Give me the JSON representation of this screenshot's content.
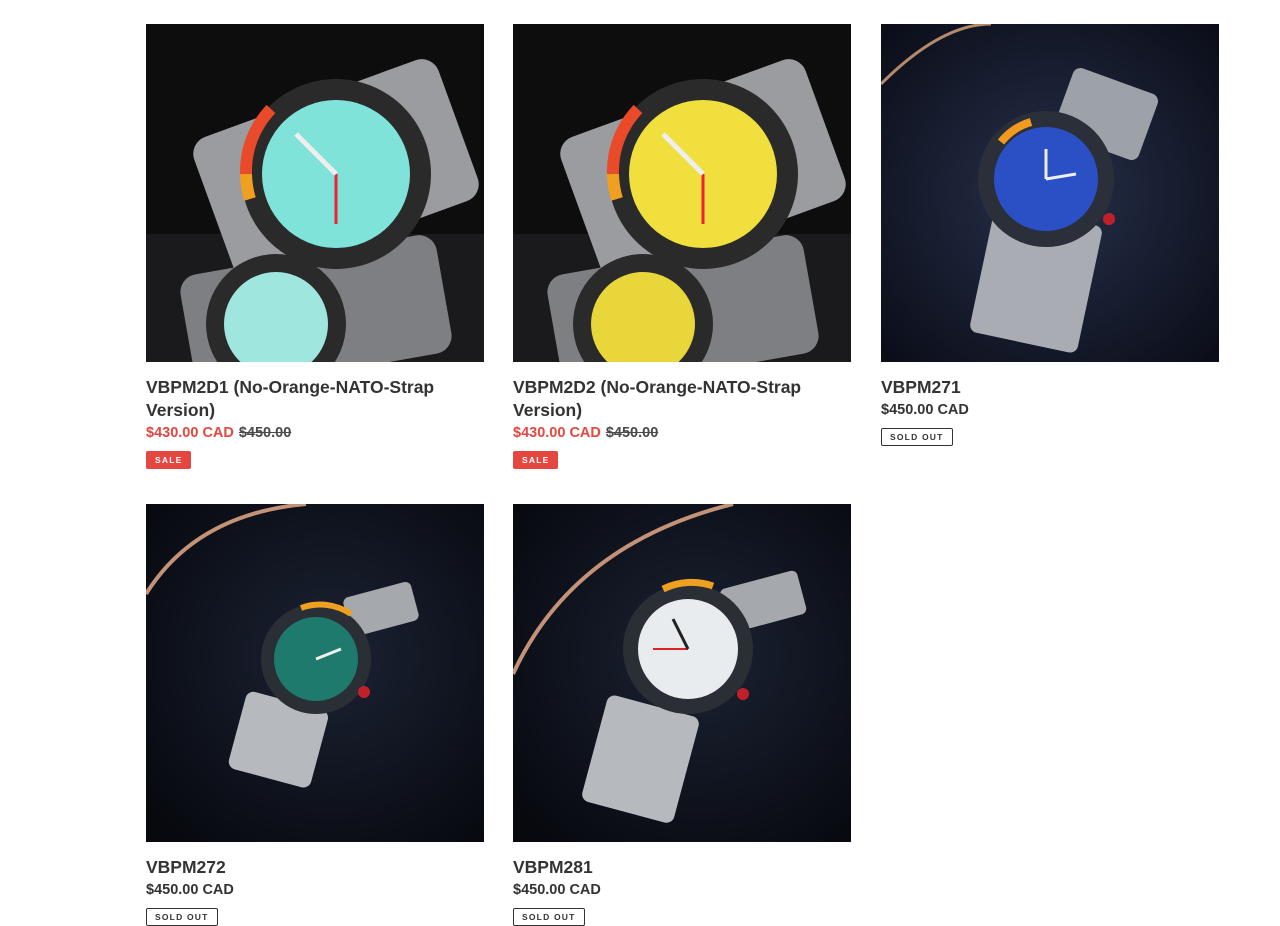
{
  "products": [
    {
      "title": "VBPM2D1 (No-Orange-NATO-Strap Version)",
      "price": "$430.00 CAD",
      "compare_price": "$450.00",
      "badge": "SALE",
      "dial_color": "#7fe3d9",
      "bg_color": "#0d0d0e"
    },
    {
      "title": "VBPM2D2 (No-Orange-NATO-Strap Version)",
      "price": "$430.00 CAD",
      "compare_price": "$450.00",
      "badge": "SALE",
      "dial_color": "#f0df3c",
      "bg_color": "#0d0d0e"
    },
    {
      "title": "VBPM271",
      "price": "$450.00 CAD",
      "badge": "SOLD OUT",
      "dial_color": "#2b4fc4",
      "bg_color": "#0e1424"
    },
    {
      "title": "VBPM272",
      "price": "$450.00 CAD",
      "badge": "SOLD OUT",
      "dial_color": "#1f7a6e",
      "bg_color": "#0b0f1a"
    },
    {
      "title": "VBPM281",
      "price": "$450.00 CAD",
      "badge": "SOLD OUT",
      "dial_color": "#e8ecef",
      "bg_color": "#0b0f1a"
    }
  ],
  "colors": {
    "sale": "#e4473f",
    "text": "#333333"
  }
}
